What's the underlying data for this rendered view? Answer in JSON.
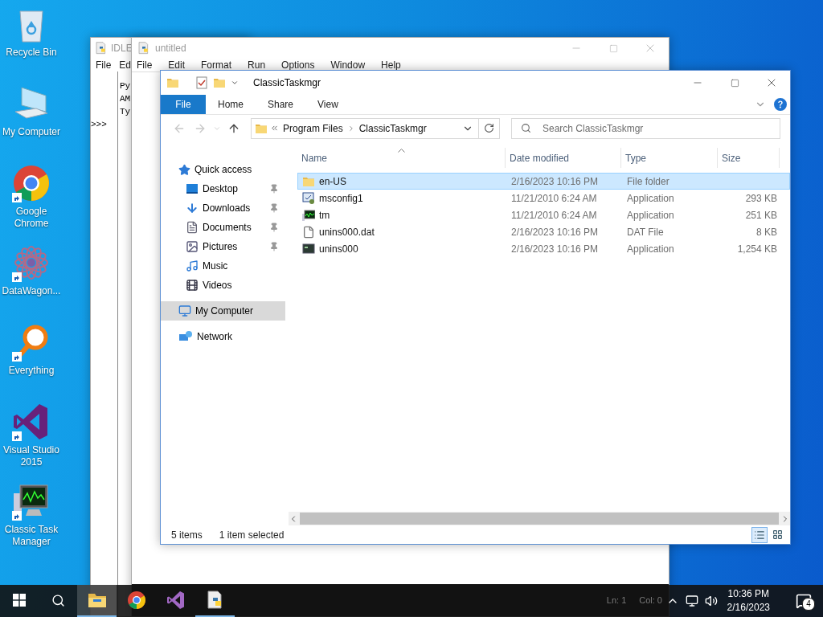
{
  "desktop_icons": [
    {
      "label": "Recycle Bin",
      "kind": "bin",
      "shortcut": false
    },
    {
      "label": "My Computer",
      "kind": "computer",
      "shortcut": false
    },
    {
      "label": "Google Chrome",
      "kind": "chrome",
      "shortcut": true
    },
    {
      "label": "DataWagon...",
      "kind": "atom",
      "shortcut": true
    },
    {
      "label": "Everything",
      "kind": "magnifier",
      "shortcut": true
    },
    {
      "label": "Visual Studio 2015",
      "kind": "studio",
      "shortcut": true
    },
    {
      "label": "Classic Task Manager",
      "kind": "monitor",
      "shortcut": true
    }
  ],
  "idle_shell": {
    "title": "IDLE",
    "menu": [
      "File",
      "Ed"
    ],
    "lines": [
      "Py",
      "AM",
      "Ty"
    ],
    "prompt": ">>>"
  },
  "editor": {
    "title": "untitled",
    "menu": [
      "File",
      "Edit",
      "Format",
      "Run",
      "Options",
      "Window",
      "Help"
    ],
    "status": [
      "Ln: 1",
      "Col: 0"
    ]
  },
  "explorer": {
    "title": "ClassicTaskmgr",
    "ribbon_tabs": [
      {
        "label": "File",
        "kind": "file"
      },
      {
        "label": "Home",
        "kind": "tab"
      },
      {
        "label": "Share",
        "kind": "tab"
      },
      {
        "label": "View",
        "kind": "tab"
      }
    ],
    "nav_buttons": [
      {
        "kind": "back",
        "disabled": true
      },
      {
        "kind": "forward",
        "disabled": true
      },
      {
        "kind": "recent",
        "disabled": true
      },
      {
        "kind": "up",
        "disabled": false
      }
    ],
    "address": {
      "crumbs": [
        "Program Files",
        "ClassicTaskmgr"
      ]
    },
    "search": {
      "placeholder": "Search ClassicTaskmgr"
    },
    "nav_pane": [
      {
        "label": "Quick access",
        "kind": "star",
        "selected": false,
        "children": [
          {
            "label": "Desktop",
            "kind": "desktop",
            "pinned": true,
            "selected": false
          },
          {
            "label": "Downloads",
            "kind": "downloads",
            "pinned": true,
            "selected": false
          },
          {
            "label": "Documents",
            "kind": "documents",
            "pinned": true,
            "selected": false
          },
          {
            "label": "Pictures",
            "kind": "pictures",
            "pinned": true,
            "selected": false
          },
          {
            "label": "Music",
            "kind": "music",
            "pinned": false,
            "selected": false
          },
          {
            "label": "Videos",
            "kind": "videos",
            "pinned": false,
            "selected": false
          }
        ]
      },
      {
        "label": "My Computer",
        "kind": "computer",
        "selected": true
      },
      {
        "label": "Network",
        "kind": "network",
        "selected": false
      }
    ],
    "columns": [
      {
        "label": "Name",
        "sorted": true
      },
      {
        "label": "Date modified",
        "sorted": false
      },
      {
        "label": "Type",
        "sorted": false
      },
      {
        "label": "Size",
        "sorted": false
      }
    ],
    "files": [
      {
        "name": "en-US",
        "kind": "folder",
        "date": "2/16/2023 10:16 PM",
        "type": "File folder",
        "selected": true
      },
      {
        "name": "msconfig1",
        "kind": "config",
        "date": "11/21/2010 6:24 AM",
        "type": "Application",
        "size": "293 KB",
        "selected": false
      },
      {
        "name": "tm",
        "kind": "monitor",
        "date": "11/21/2010 6:24 AM",
        "type": "Application",
        "size": "251 KB",
        "selected": false
      },
      {
        "name": "unins000.dat",
        "kind": "file",
        "date": "2/16/2023 10:16 PM",
        "type": "DAT File",
        "size": "8 KB",
        "selected": false
      },
      {
        "name": "unins000",
        "kind": "installer",
        "date": "2/16/2023 10:16 PM",
        "type": "Application",
        "size": "1,254 KB",
        "selected": false
      }
    ],
    "status": {
      "count": "5 items",
      "selection": "1 item selected"
    },
    "view_buttons": [
      {
        "kind": "details",
        "selected": true
      },
      {
        "kind": "thumbnails",
        "selected": false
      }
    ]
  },
  "taskbar": {
    "apps": [
      {
        "kind": "explorer",
        "running": true,
        "active": true
      },
      {
        "kind": "chrome",
        "running": false,
        "active": false
      },
      {
        "kind": "studio",
        "running": false,
        "active": false
      },
      {
        "kind": "python",
        "running": true,
        "active": false
      }
    ],
    "clock": {
      "time": "10:36 PM",
      "date": "2/16/2023"
    },
    "notifications": "4"
  }
}
